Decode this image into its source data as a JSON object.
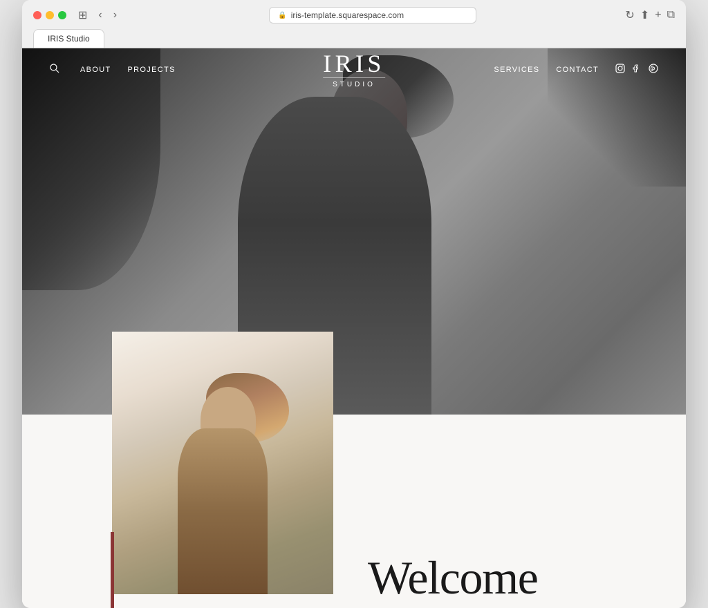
{
  "browser": {
    "url": "iris-template.squarespace.com",
    "tab_label": "IRIS Studio"
  },
  "nav": {
    "search_placeholder": "Search",
    "links_left": [
      "ABOUT",
      "PROJECTS"
    ],
    "logo_title": "IRIS",
    "logo_subtitle": "STUDIO",
    "links_right": [
      "SERVICES",
      "CONTACT"
    ],
    "social": [
      "instagram",
      "facebook",
      "pinterest"
    ]
  },
  "hero": {
    "alt": "Black and white photo of woman in overalls"
  },
  "lower": {
    "portrait_alt": "Woman in beige sweater",
    "welcome_text": "Welcome"
  }
}
